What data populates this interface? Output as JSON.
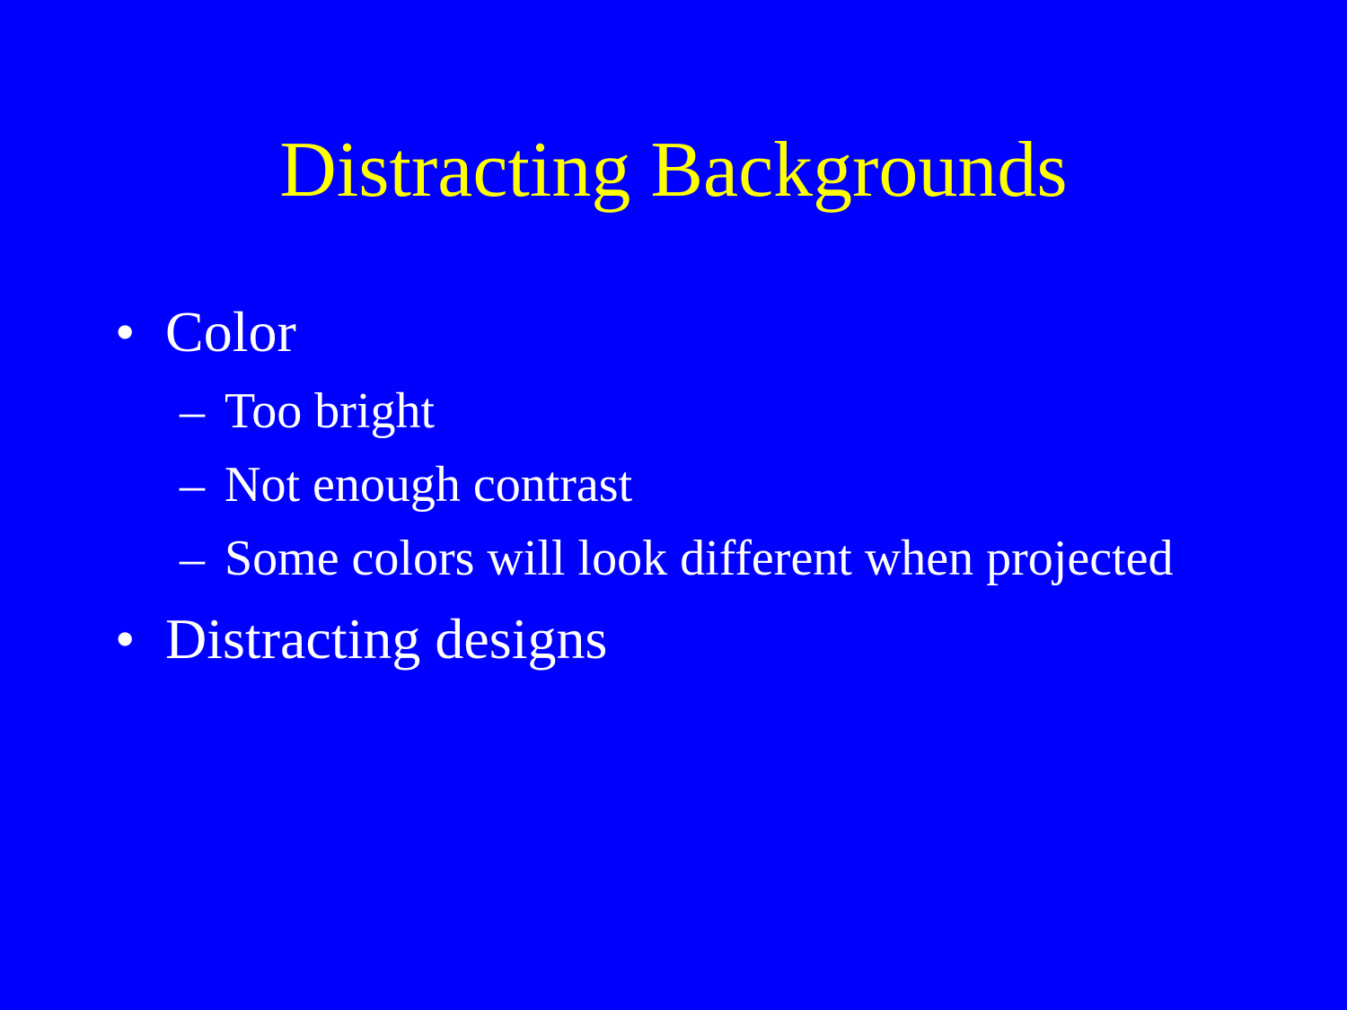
{
  "slide": {
    "title": "Distracting Backgrounds",
    "bullet_marker": "•",
    "sub_marker": "–",
    "items": [
      {
        "text": "Color",
        "subitems": [
          "Too bright",
          "Not enough contrast",
          "Some colors will look different when projected"
        ]
      },
      {
        "text": "Distracting designs",
        "subitems": []
      }
    ]
  },
  "colors": {
    "background": "#0000FF",
    "title": "#FFFF00",
    "body_text": "#FFFFFF"
  }
}
